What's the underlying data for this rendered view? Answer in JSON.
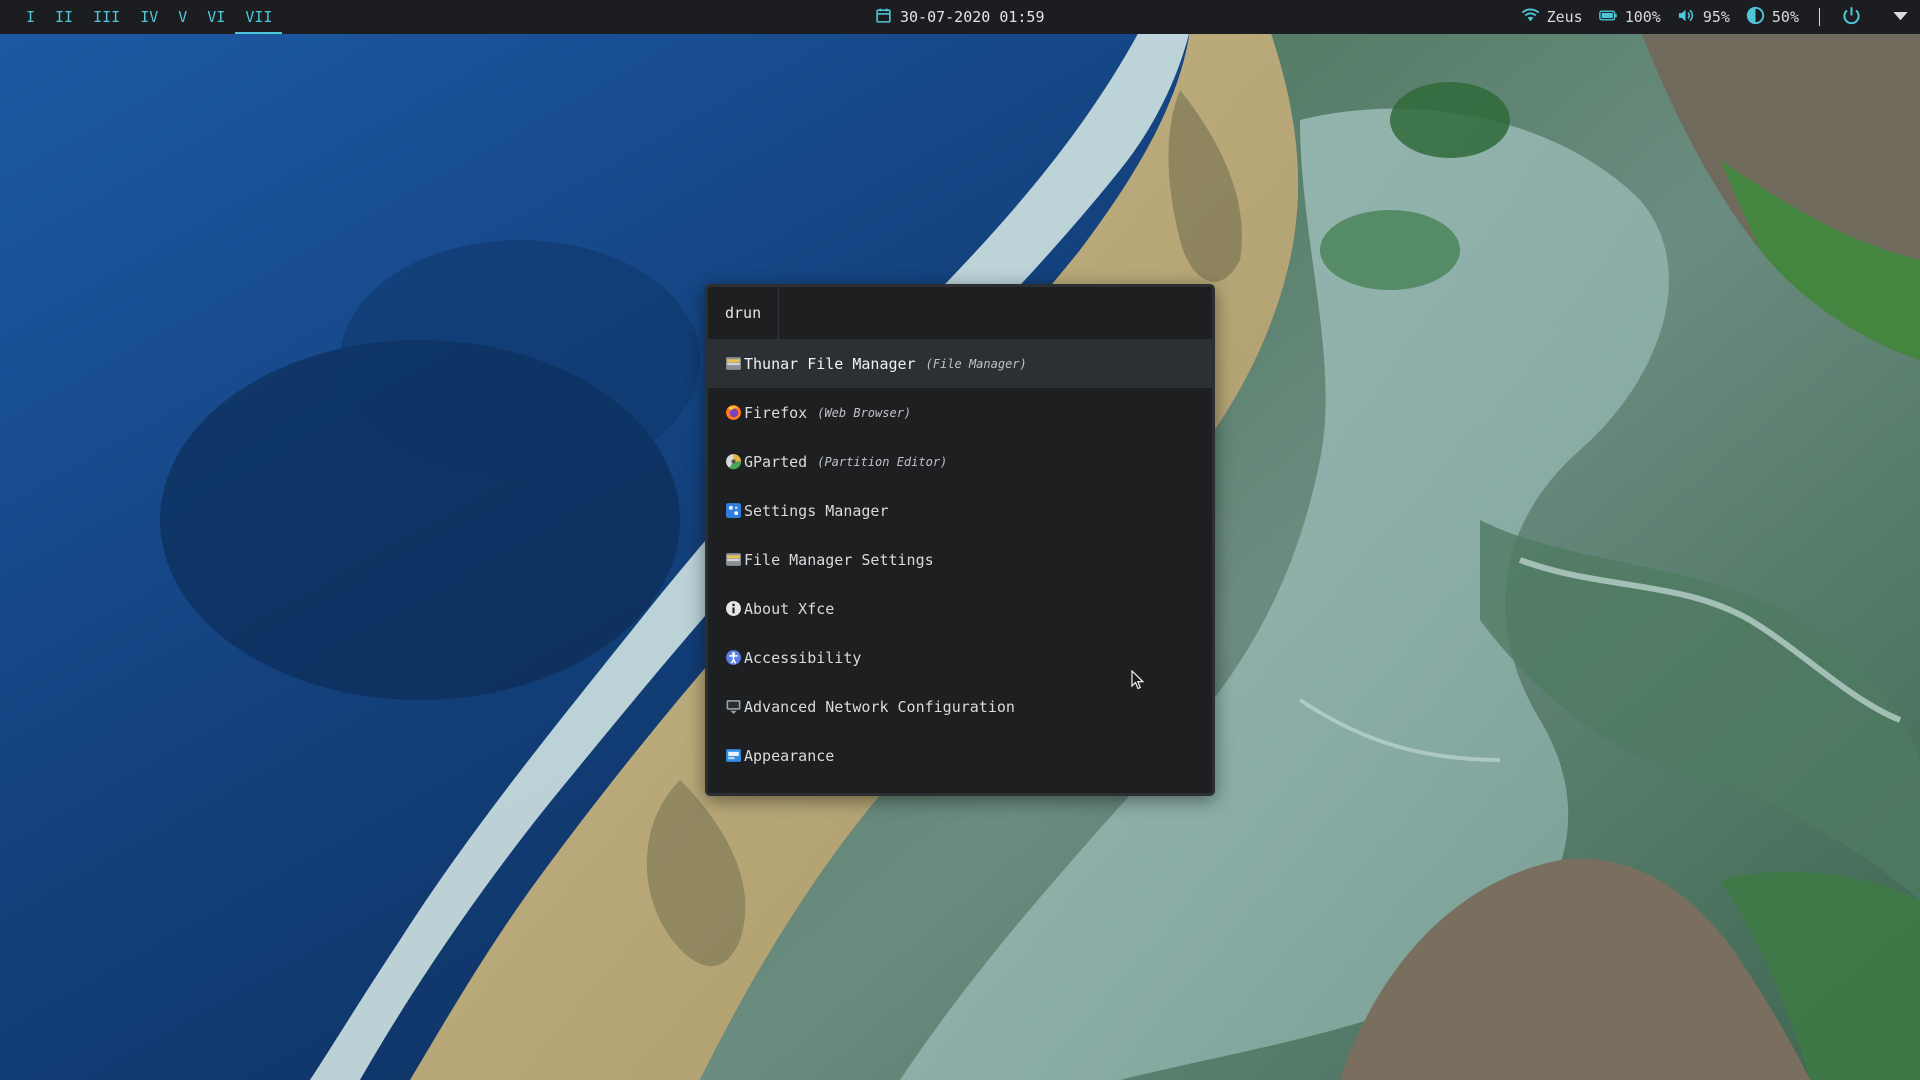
{
  "topbar": {
    "workspaces": [
      {
        "label": "I",
        "active": false
      },
      {
        "label": "II",
        "active": false
      },
      {
        "label": "III",
        "active": false
      },
      {
        "label": "IV",
        "active": false
      },
      {
        "label": "V",
        "active": false
      },
      {
        "label": "VI",
        "active": false
      },
      {
        "label": "VII",
        "active": true
      }
    ],
    "clock": {
      "icon": "calendar-icon",
      "text": "30-07-2020 01:59"
    },
    "tray": {
      "wifi": {
        "icon": "wifi-icon",
        "text": "Zeus"
      },
      "battery": {
        "icon": "battery-icon",
        "text": "100%"
      },
      "volume": {
        "icon": "volume-icon",
        "text": "95%"
      },
      "brightness": {
        "icon": "brightness-icon",
        "text": "50%"
      },
      "power": {
        "icon": "power-icon"
      },
      "menu": {
        "icon": "dropdown-triangle-icon"
      }
    }
  },
  "launcher": {
    "prompt": "drun",
    "entry_value": "",
    "items": [
      {
        "label": "Thunar File Manager",
        "desc": "(File Manager)",
        "icon": "folder-icon",
        "selected": true
      },
      {
        "label": "Firefox",
        "desc": "(Web Browser)",
        "icon": "firefox-icon",
        "selected": false
      },
      {
        "label": "GParted",
        "desc": "(Partition Editor)",
        "icon": "gparted-icon",
        "selected": false
      },
      {
        "label": "Settings Manager",
        "desc": "",
        "icon": "settings-icon",
        "selected": false
      },
      {
        "label": "File Manager Settings",
        "desc": "",
        "icon": "folder-icon",
        "selected": false
      },
      {
        "label": "About Xfce",
        "desc": "",
        "icon": "info-icon",
        "selected": false
      },
      {
        "label": "Accessibility",
        "desc": "",
        "icon": "accessibility-icon",
        "selected": false
      },
      {
        "label": "Advanced Network Configuration",
        "desc": "",
        "icon": "network-icon",
        "selected": false
      },
      {
        "label": "Appearance",
        "desc": "",
        "icon": "appearance-icon",
        "selected": false
      }
    ]
  },
  "colors": {
    "accent": "#4fc6d8",
    "bar_bg": "#1b1d20",
    "launcher_bg": "#1e1f21",
    "selected_bg": "#2c2f33"
  }
}
